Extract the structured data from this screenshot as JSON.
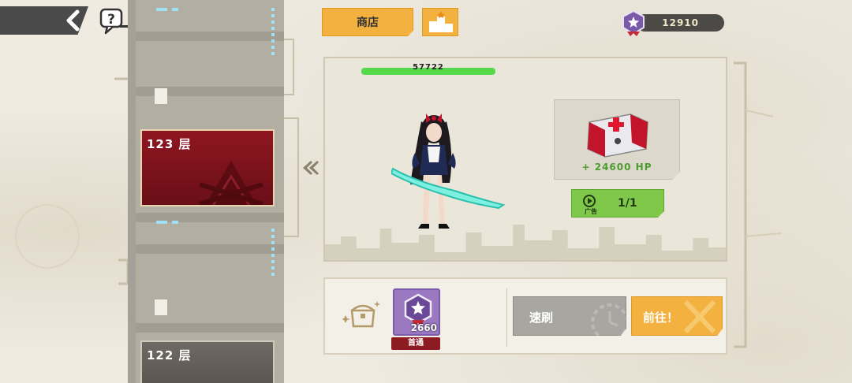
{
  "nav": {
    "back_icon": "chevron-left-icon",
    "help_icon": "question-bubble-icon"
  },
  "toolbar": {
    "shop_label": "商店",
    "rank_icon": "podium-icon"
  },
  "currency": {
    "icon": "star-medal-icon",
    "amount": "12910"
  },
  "tower": {
    "floors": [
      {
        "label": "123 层",
        "state": "current"
      },
      {
        "label": "122 层",
        "state": "cleared"
      }
    ]
  },
  "battle": {
    "enemy_hp": "57722",
    "enemy_hp_fill": 1.0,
    "reward": {
      "icon": "medkit-icon",
      "text": "+ 24600 HP"
    },
    "ad_button": {
      "icon_label": "广告",
      "count": "1/1"
    }
  },
  "bottom": {
    "chest_icon": "treasure-chest-icon",
    "medal_value": "2660",
    "first_clear_label": "首通",
    "sweep_label": "速刷",
    "go_label": "前往！"
  },
  "colors": {
    "accent": "#f3b23f",
    "floor_current": "#8e1621",
    "hp_green": "#55d94b",
    "ad_green": "#7fc84a"
  }
}
